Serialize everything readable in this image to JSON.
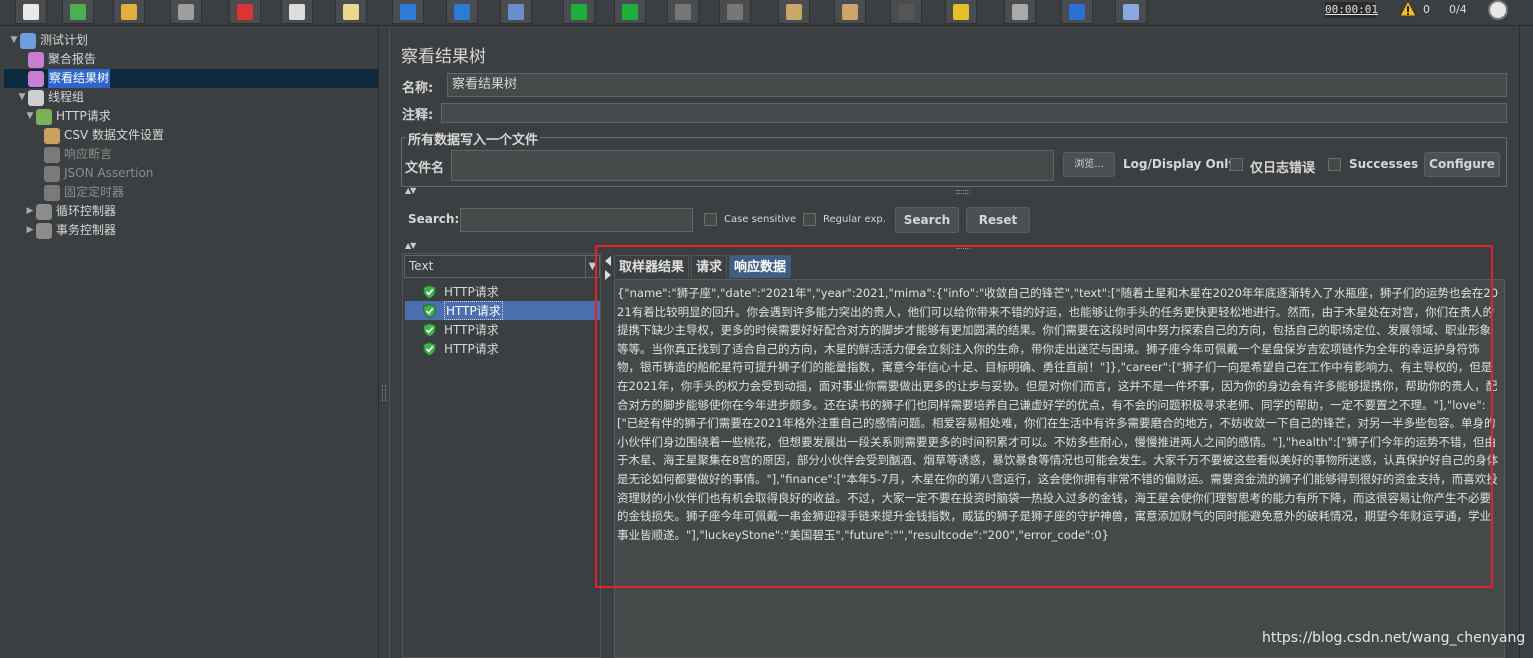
{
  "colors": {
    "bg": "#3c3f41",
    "field": "#45494a",
    "selection": "#2f65ca",
    "tab_active": "#3e5e85",
    "highlight": "#e8202a",
    "success_shield": "#3fb34f"
  },
  "toolbar": {
    "icons": [
      "new-icon",
      "templates-icon",
      "open-icon",
      "save-icon",
      "cut-icon",
      "copy-icon",
      "paste-icon",
      "expand-icon",
      "collapse-icon",
      "toggle-icon",
      "start-icon",
      "start-no-pause-icon",
      "stop-icon",
      "shutdown-icon",
      "clear-icon",
      "clear-all-icon",
      "search-icon",
      "reset-search-icon",
      "function-helper-icon",
      "help-icon",
      "remote-icon"
    ],
    "timer": "00:00:01",
    "warning_count": "0",
    "threads": "0/4"
  },
  "tree": {
    "items": [
      {
        "label": "测试计划",
        "icon": "test-plan-icon",
        "level": 0,
        "arrow": "▼"
      },
      {
        "label": "聚合报告",
        "icon": "report-icon",
        "level": 1,
        "arrow": ""
      },
      {
        "label": "察看结果树",
        "icon": "report-icon",
        "level": 1,
        "arrow": "",
        "selected": true
      },
      {
        "label": "线程组",
        "icon": "gear-icon",
        "level": 1,
        "arrow": "▼"
      },
      {
        "label": "HTTP请求",
        "icon": "sampler-icon",
        "level": 2,
        "arrow": "▼"
      },
      {
        "label": "CSV 数据文件设置",
        "icon": "config-icon",
        "level": 3,
        "arrow": ""
      },
      {
        "label": "响应断言",
        "icon": "assertion-icon",
        "level": 3,
        "arrow": "",
        "disabled": true
      },
      {
        "label": "JSON Assertion",
        "icon": "assertion-icon",
        "level": 3,
        "arrow": "",
        "disabled": true
      },
      {
        "label": "固定定时器",
        "icon": "timer-icon",
        "level": 3,
        "arrow": "",
        "disabled": true
      },
      {
        "label": "循环控制器",
        "icon": "controller-icon",
        "level": 2,
        "arrow": "▶"
      },
      {
        "label": "事务控制器",
        "icon": "controller-icon",
        "level": 2,
        "arrow": "▶"
      }
    ]
  },
  "panel": {
    "title": "察看结果树",
    "name_label": "名称:",
    "name_value": "察看结果树",
    "comment_label": "注释:",
    "comment_value": "",
    "file_group_title": "所有数据写入一个文件",
    "filename_label": "文件名",
    "filename_value": "",
    "browse_label": "浏览...",
    "log_display_label": "Log/Display Only:",
    "errors_only_label": "仅日志错误",
    "successes_label": "Successes",
    "configure_label": "Configure"
  },
  "search": {
    "label": "Search:",
    "value": "",
    "case_sensitive_label": "Case sensitive",
    "regex_label": "Regular exp.",
    "search_button": "Search",
    "reset_button": "Reset"
  },
  "results": {
    "renderer": "Text",
    "rows": [
      {
        "label": "HTTP请求",
        "selected": false
      },
      {
        "label": "HTTP请求",
        "selected": true
      },
      {
        "label": "HTTP请求",
        "selected": false
      },
      {
        "label": "HTTP请求",
        "selected": false
      }
    ]
  },
  "tabs": [
    {
      "label": "取样器结果",
      "active": false
    },
    {
      "label": "请求",
      "active": false
    },
    {
      "label": "响应数据",
      "active": true
    }
  ],
  "response_text": "{\"name\":\"狮子座\",\"date\":\"2021年\",\"year\":2021,\"mima\":{\"info\":\"收敛自己的锋芒\",\"text\":[\"随着土星和木星在2020年年底逐渐转入了水瓶座，狮子们的运势也会在2021有着比较明显的回升。你会遇到许多能力突出的贵人，他们可以给你带来不错的好运，也能够让你手头的任务更快更轻松地进行。然而，由于木星处在对宫，你们在贵人的提携下缺少主导权，更多的时候需要好好配合对方的脚步才能够有更加圆满的结果。你们需要在这段时间中努力探索自己的方向，包括自己的职场定位、发展领域、职业形象等等。当你真正找到了适合自己的方向，木星的鲜活活力便会立刻注入你的生命，带你走出迷茫与困境。狮子座今年可佩戴一个星盘保岁吉宏项链作为全年的幸运护身符饰物，银币铸造的船舵星符可提升狮子们的能量指数，寓意今年信心十足、目标明确、勇往直前！\"]},\"career\":[\"狮子们一向是希望自己在工作中有影响力、有主导权的，但是在2021年，你手头的权力会受到动摇，面对事业你需要做出更多的让步与妥协。但是对你们而言，这并不是一件坏事，因为你的身边会有许多能够提携你，帮助你的贵人，配合对方的脚步能够使你在今年进步颇多。还在读书的狮子们也同样需要培养自己谦虚好学的优点，有不会的问题积极寻求老师、同学的帮助，一定不要置之不理。\"],\"love\":[\"已经有伴的狮子们需要在2021年格外注重自己的感情问题。相爱容易相处难，你们在生活中有许多需要磨合的地方，不妨收敛一下自己的锋芒，对另一半多些包容。单身的小伙伴们身边围绕着一些桃花，但想要发展出一段关系则需要更多的时间积累才可以。不妨多些耐心，慢慢推进两人之间的感情。\"],\"health\":[\"狮子们今年的运势不错，但由于木星、海王星聚集在8宫的原因，部分小伙伴会受到酗酒、烟草等诱惑，暴饮暴食等情况也可能会发生。大家千万不要被这些看似美好的事物所迷惑，认真保护好自己的身体是无论如何都要做好的事情。\"],\"finance\":[\"本年5-7月，木星在你的第八宫运行，这会使你拥有非常不错的偏财运。需要资金流的狮子们能够得到很好的资金支持，而喜欢投资理财的小伙伴们也有机会取得良好的收益。不过，大家一定不要在投资时脑袋一热投入过多的金钱，海王星会使你们理智思考的能力有所下降，而这很容易让你产生不必要的金钱损失。狮子座今年可佩戴一串金狮迎禄手链来提升金钱指数，威猛的狮子是狮子座的守护神兽，寓意添加财气的同时能避免意外的破耗情况，期望今年财运亨通，学业事业皆顺遂。\"],\"luckeyStone\":\"美国碧玉\",\"future\":\"\",\"resultcode\":\"200\",\"error_code\":0}",
  "watermark": "https://blog.csdn.net/wang_chenyang"
}
